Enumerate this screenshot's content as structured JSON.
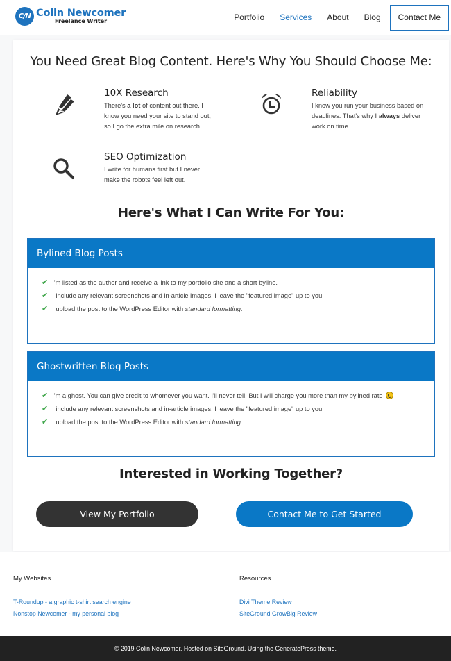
{
  "header": {
    "logo": {
      "badge": "C/N",
      "name": "Colin Newcomer",
      "tagline": "Freelance Writer"
    },
    "nav": [
      {
        "label": "Portfolio",
        "active": false
      },
      {
        "label": "Services",
        "active": true
      },
      {
        "label": "About",
        "active": false
      },
      {
        "label": "Blog",
        "active": false
      }
    ],
    "cta": "Contact Me"
  },
  "main": {
    "heading": "You Need Great Blog Content. Here's Why You Should Choose Me:",
    "features": [
      {
        "icon": "pencil-icon",
        "title": "10X Research",
        "desc_pre": "There's ",
        "desc_bold": "a lot",
        "desc_post": " of content out there. I know you need your site to stand out, so I go the extra mile on research."
      },
      {
        "icon": "alarm-clock-icon",
        "title": "Reliability",
        "desc_pre": "I know you run your business based on deadlines. That's why I ",
        "desc_bold": "always",
        "desc_post": " deliver work on time."
      },
      {
        "icon": "search-icon",
        "title": "SEO Optimization",
        "desc_pre": "I write for humans first but I never make the robots feel left out.",
        "desc_bold": "",
        "desc_post": ""
      }
    ],
    "services_heading": "Here's What I Can Write For You:",
    "services": [
      {
        "title": "Bylined Blog Posts",
        "items": [
          {
            "text": "I'm listed as the author and receive a link to my portfolio site and a short byline.",
            "em": ""
          },
          {
            "text": "I include any relevant screenshots and in-article images. I leave the \"featured image\" up to you.",
            "em": ""
          },
          {
            "text": "I upload the post to the WordPress Editor with ",
            "em": "standard formatting",
            "after": "."
          }
        ]
      },
      {
        "title": "Ghostwritten Blog Posts",
        "items": [
          {
            "text": "I'm a ghost. You can give credit to whomever you want. I'll never tell. But I will charge you more than my bylined rate",
            "em": "",
            "emoji": "smiley"
          },
          {
            "text": "I include any relevant screenshots and in-article images. I leave the \"featured image\" up to you.",
            "em": ""
          },
          {
            "text": "I upload the post to the WordPress Editor with ",
            "em": "standard formatting",
            "after": "."
          }
        ]
      }
    ],
    "cta_heading": "Interested in Working Together?",
    "buttons": {
      "portfolio": "View My Portfolio",
      "contact": "Contact Me to Get Started"
    }
  },
  "footer": {
    "widgets": [
      {
        "title": "My Websites",
        "links": [
          "T-Roundup - a graphic t-shirt search engine",
          "Nonstop Newcomer - my personal blog"
        ]
      },
      {
        "title": "Resources",
        "links": [
          "Divi Theme Review",
          "SiteGround GrowBig Review"
        ]
      }
    ],
    "copyright": "© 2019 Colin Newcomer. Hosted on SiteGround. Using the GeneratePress theme."
  },
  "colors": {
    "accent": "#1e73be",
    "service_header": "#0a78c6",
    "check": "#3fa64a",
    "dark_button": "#333333",
    "footer_bar": "#222222"
  }
}
